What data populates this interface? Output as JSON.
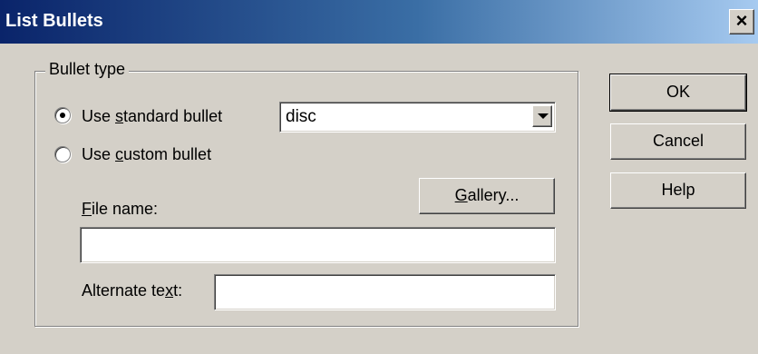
{
  "dialog": {
    "title": "List Bullets",
    "close_glyph": "×",
    "close_icon": "close-icon"
  },
  "bullet_type": {
    "group_label": "Bullet type",
    "standard": {
      "label_before": "Use ",
      "label_accel": "s",
      "label_after": "tandard bullet",
      "selected": true
    },
    "custom": {
      "label_before": "Use ",
      "label_accel": "c",
      "label_after": "ustom bullet",
      "selected": false
    },
    "standard_select": {
      "value": "disc",
      "dropdown_icon": "chevron-down-icon"
    },
    "gallery_button": {
      "accel": "G",
      "rest": "allery..."
    },
    "file_name": {
      "accel": "F",
      "rest": "ile name:",
      "value": ""
    },
    "alternate_text": {
      "before": "Alternate te",
      "accel": "x",
      "after": "t:",
      "value": ""
    }
  },
  "actions": {
    "ok": "OK",
    "cancel": "Cancel",
    "help": "Help"
  }
}
